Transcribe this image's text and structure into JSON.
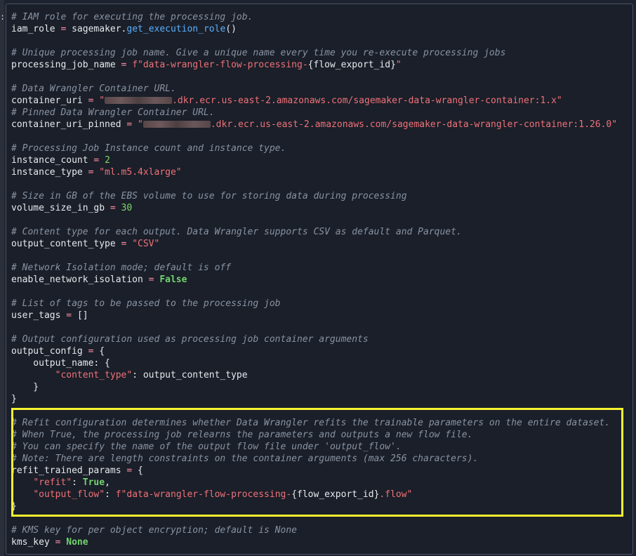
{
  "gutter": {
    "marker": ":"
  },
  "code": {
    "c_iam": "# IAM role for executing the processing job.",
    "iam_var": "iam_role",
    "iam_obj": "sagemaker.",
    "iam_fn": "get_execution_role",
    "iam_tail": "()",
    "c_job": "# Unique processing job name. Give a unique name every time you re-execute processing jobs",
    "job_var": "processing_job_name",
    "job_prefix": "f",
    "job_str1": "\"data-wrangler-flow-processing-",
    "job_interp": "{flow_export_id}",
    "job_str2": "\"",
    "c_cont": "# Data Wrangler Container URL.",
    "cont_var": "container_uri",
    "cont_q": "\"",
    "cont_str": ".dkr.ecr.us-east-2.amazonaws.com/sagemaker-data-wrangler-container:1.x\"",
    "c_pinned": "# Pinned Data Wrangler Container URL.",
    "pinned_var": "container_uri_pinned",
    "pinned_q": "\"",
    "pinned_str": ".dkr.ecr.us-east-2.amazonaws.com/sagemaker-data-wrangler-container:1.26.0\"",
    "c_inst": "# Processing Job Instance count and instance type.",
    "icount_var": "instance_count",
    "icount_val": "2",
    "itype_var": "instance_type",
    "itype_val": "\"ml.m5.4xlarge\"",
    "c_vol": "# Size in GB of the EBS volume to use for storing data during processing",
    "vol_var": "volume_size_in_gb",
    "vol_val": "30",
    "c_content": "# Content type for each output. Data Wrangler supports CSV as default and Parquet.",
    "oct_var": "output_content_type",
    "oct_val": "\"CSV\"",
    "c_net": "# Network Isolation mode; default is off",
    "net_var": "enable_network_isolation",
    "net_val": "False",
    "c_tags": "# List of tags to be passed to the processing job",
    "tags_var": "user_tags",
    "tags_val": "[]",
    "c_outcfg": "# Output configuration used as processing job container arguments",
    "outcfg_var": "output_config",
    "outcfg_open": "{",
    "outname_line": "    output_name: {",
    "ct_indent": "        ",
    "ct_key": "\"content_type\"",
    "ct_val": ": output_content_type",
    "inner_close": "    }",
    "outer_close": "}",
    "c_refit1": "# Refit configuration determines whether Data Wrangler refits the trainable parameters on the entire dataset.",
    "c_refit2": "# When True, the processing job relearns the parameters and outputs a new flow file.",
    "c_refit3": "# You can specify the name of the output flow file under 'output_flow'.",
    "c_refit4": "# Note: There are length constraints on the container arguments (max 256 characters).",
    "refit_var": "refit_trained_params",
    "refit_open": "{",
    "refit_key": "\"refit\"",
    "refit_val": "True",
    "refit_comma": ",",
    "of_key": "\"output_flow\"",
    "of_prefix": "f",
    "of_str1": "\"data-wrangler-flow-processing-",
    "of_interp": "{flow_export_id}",
    "of_str2": ".flow\"",
    "refit_close": "}",
    "c_kms": "# KMS key for per object encryption; default is None",
    "kms_var": "kms_key",
    "kms_val": "None",
    "eq": " = ",
    "colon_sep": ": "
  },
  "colors": {
    "background": "#1a1f29",
    "comment": "#8a93a3",
    "string": "#f07178",
    "number": "#7fd86a",
    "keyword": "#73d36e",
    "function": "#5ab0ff",
    "highlight_border": "#f6f230"
  }
}
